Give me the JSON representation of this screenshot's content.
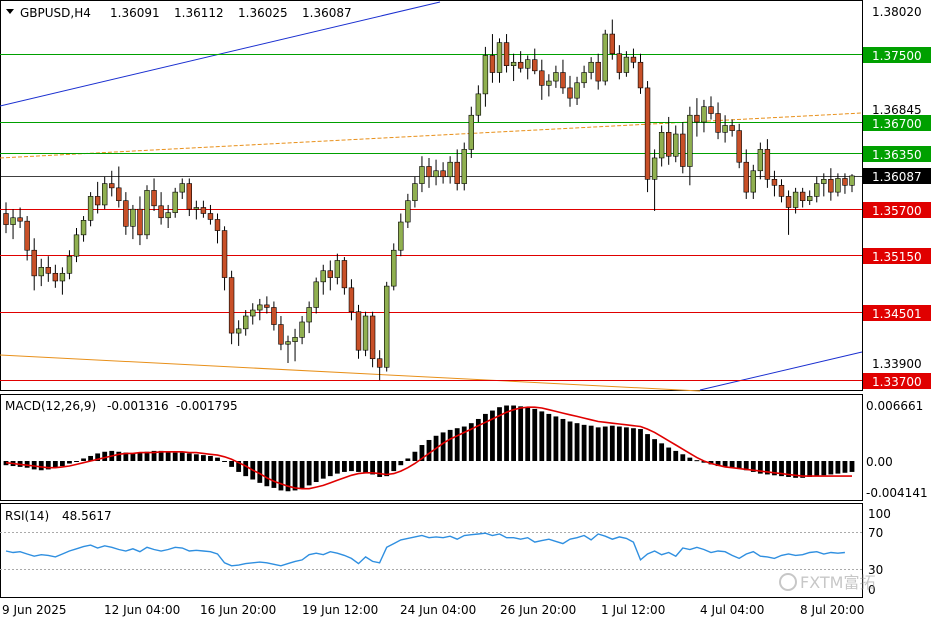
{
  "header": {
    "symbol": "GBPUSD,H4",
    "open": "1.36091",
    "high": "1.36112",
    "low": "1.36025",
    "close": "1.36087"
  },
  "macd": {
    "label": "MACD(12,26,9)",
    "main": "-0.001316",
    "signal": "-0.001795",
    "axis_ticks": [
      "0.006661",
      "0.00",
      "-0.004141"
    ]
  },
  "rsi": {
    "label": "RSI(14)",
    "value": "48.5617",
    "axis_ticks": [
      "100",
      "70",
      "30",
      "0"
    ]
  },
  "watermark": "FXTM富拓",
  "colors": {
    "bull": "#90b050",
    "bear": "#c85028",
    "support": "#e00000",
    "resistance": "#00a000",
    "trend_blue": "#1a2fd0",
    "trend_orange": "#e8901a",
    "signal": "#e00000",
    "rsi_line": "#2f8fe0"
  },
  "chart_data": [
    {
      "type": "candlestick",
      "price_range": [
        1.3333,
        1.3821
      ],
      "price_axis_ticks": [
        "1.38020",
        "1.36845",
        "1.33900"
      ],
      "current_price": "1.36087",
      "levels": {
        "resistance": [
          "1.37500",
          "1.36700",
          "1.36350"
        ],
        "support": [
          "1.35700",
          "1.35150",
          "1.34501",
          "1.33700"
        ]
      },
      "x_tick_labels": [
        "9 Jun 2025",
        "12 Jun 04:00",
        "16 Jun 20:00",
        "19 Jun 12:00",
        "24 Jun 04:00",
        "26 Jun 20:00",
        "1 Jul 12:00",
        "4 Jul 04:00",
        "8 Jul 20:00"
      ],
      "ohlc": [
        [
          1.3565,
          1.3578,
          1.3542,
          1.3552
        ],
        [
          1.3552,
          1.357,
          1.3535,
          1.356
        ],
        [
          1.356,
          1.3572,
          1.3548,
          1.3556
        ],
        [
          1.3556,
          1.3562,
          1.351,
          1.3522
        ],
        [
          1.3522,
          1.3536,
          1.3475,
          1.3492
        ],
        [
          1.3492,
          1.3512,
          1.348,
          1.3502
        ],
        [
          1.3502,
          1.3515,
          1.3485,
          1.3495
        ],
        [
          1.3495,
          1.3505,
          1.3478,
          1.3486
        ],
        [
          1.3486,
          1.3502,
          1.347,
          1.3495
        ],
        [
          1.3495,
          1.3522,
          1.3488,
          1.3515
        ],
        [
          1.3515,
          1.3548,
          1.3508,
          1.354
        ],
        [
          1.354,
          1.3562,
          1.3532,
          1.3557
        ],
        [
          1.3557,
          1.359,
          1.355,
          1.3585
        ],
        [
          1.3585,
          1.3602,
          1.3565,
          1.3575
        ],
        [
          1.3575,
          1.3608,
          1.357,
          1.36
        ],
        [
          1.36,
          1.3615,
          1.3585,
          1.3595
        ],
        [
          1.3595,
          1.362,
          1.3572,
          1.358
        ],
        [
          1.358,
          1.359,
          1.354,
          1.355
        ],
        [
          1.355,
          1.3575,
          1.3535,
          1.357
        ],
        [
          1.357,
          1.3585,
          1.3528,
          1.354
        ],
        [
          1.354,
          1.3598,
          1.3535,
          1.3592
        ],
        [
          1.3592,
          1.3606,
          1.3568,
          1.3574
        ],
        [
          1.3574,
          1.359,
          1.3552,
          1.356
        ],
        [
          1.356,
          1.3575,
          1.3548,
          1.3566
        ],
        [
          1.3566,
          1.3595,
          1.356,
          1.359
        ],
        [
          1.359,
          1.3606,
          1.3582,
          1.36
        ],
        [
          1.36,
          1.3606,
          1.3562,
          1.357
        ],
        [
          1.357,
          1.358,
          1.3558,
          1.3572
        ],
        [
          1.3572,
          1.358,
          1.356,
          1.3565
        ],
        [
          1.3565,
          1.3575,
          1.3552,
          1.3558
        ],
        [
          1.3558,
          1.3565,
          1.353,
          1.3545
        ],
        [
          1.3545,
          1.355,
          1.3475,
          1.349
        ],
        [
          1.349,
          1.3498,
          1.3412,
          1.3425
        ],
        [
          1.3425,
          1.344,
          1.341,
          1.343
        ],
        [
          1.343,
          1.3452,
          1.3422,
          1.3445
        ],
        [
          1.3445,
          1.346,
          1.3435,
          1.3452
        ],
        [
          1.3452,
          1.3465,
          1.344,
          1.3458
        ],
        [
          1.3458,
          1.3468,
          1.3448,
          1.3455
        ],
        [
          1.3455,
          1.3462,
          1.3428,
          1.3435
        ],
        [
          1.3435,
          1.3445,
          1.3405,
          1.3412
        ],
        [
          1.3412,
          1.3422,
          1.339,
          1.3415
        ],
        [
          1.3415,
          1.343,
          1.3392,
          1.342
        ],
        [
          1.342,
          1.3445,
          1.3412,
          1.3438
        ],
        [
          1.3438,
          1.3462,
          1.3425,
          1.3455
        ],
        [
          1.3455,
          1.349,
          1.3448,
          1.3485
        ],
        [
          1.3485,
          1.3505,
          1.347,
          1.3498
        ],
        [
          1.3498,
          1.351,
          1.3475,
          1.349
        ],
        [
          1.349,
          1.3518,
          1.3482,
          1.351
        ],
        [
          1.351,
          1.3514,
          1.347,
          1.3478
        ],
        [
          1.3478,
          1.3488,
          1.344,
          1.345
        ],
        [
          1.345,
          1.3458,
          1.3395,
          1.3405
        ],
        [
          1.3405,
          1.345,
          1.3398,
          1.3445
        ],
        [
          1.3445,
          1.345,
          1.3385,
          1.3395
        ],
        [
          1.3395,
          1.3405,
          1.337,
          1.3385
        ],
        [
          1.3385,
          1.3485,
          1.338,
          1.348
        ],
        [
          1.348,
          1.353,
          1.3475,
          1.3522
        ],
        [
          1.3522,
          1.3565,
          1.3515,
          1.3555
        ],
        [
          1.3555,
          1.3588,
          1.3548,
          1.358
        ],
        [
          1.358,
          1.3608,
          1.3572,
          1.36
        ],
        [
          1.36,
          1.3632,
          1.359,
          1.362
        ],
        [
          1.362,
          1.363,
          1.3595,
          1.3608
        ],
        [
          1.3608,
          1.3628,
          1.3598,
          1.3615
        ],
        [
          1.3615,
          1.3625,
          1.36,
          1.3608
        ],
        [
          1.3608,
          1.3632,
          1.36,
          1.3625
        ],
        [
          1.3625,
          1.364,
          1.3592,
          1.36
        ],
        [
          1.36,
          1.3648,
          1.3592,
          1.364
        ],
        [
          1.364,
          1.369,
          1.363,
          1.368
        ],
        [
          1.368,
          1.3715,
          1.3672,
          1.3705
        ],
        [
          1.3705,
          1.376,
          1.369,
          1.375
        ],
        [
          1.375,
          1.3775,
          1.3718,
          1.373
        ],
        [
          1.373,
          1.377,
          1.3718,
          1.3765
        ],
        [
          1.3765,
          1.3775,
          1.373,
          1.3738
        ],
        [
          1.3738,
          1.3752,
          1.372,
          1.3742
        ],
        [
          1.3742,
          1.3755,
          1.373,
          1.3735
        ],
        [
          1.3735,
          1.375,
          1.3722,
          1.3745
        ],
        [
          1.3745,
          1.3758,
          1.3728,
          1.3732
        ],
        [
          1.3732,
          1.3745,
          1.3698,
          1.3715
        ],
        [
          1.3715,
          1.3728,
          1.3702,
          1.372
        ],
        [
          1.372,
          1.3738,
          1.3712,
          1.373
        ],
        [
          1.373,
          1.3745,
          1.3705,
          1.3712
        ],
        [
          1.3712,
          1.3726,
          1.369,
          1.37
        ],
        [
          1.37,
          1.3725,
          1.3692,
          1.3718
        ],
        [
          1.3718,
          1.3738,
          1.3712,
          1.373
        ],
        [
          1.373,
          1.3748,
          1.3722,
          1.3742
        ],
        [
          1.3742,
          1.3752,
          1.371,
          1.372
        ],
        [
          1.372,
          1.378,
          1.3715,
          1.3775
        ],
        [
          1.3775,
          1.3792,
          1.3745,
          1.3752
        ],
        [
          1.3752,
          1.3762,
          1.3722,
          1.373
        ],
        [
          1.373,
          1.3755,
          1.3725,
          1.3748
        ],
        [
          1.3748,
          1.3758,
          1.3735,
          1.3742
        ],
        [
          1.3742,
          1.3752,
          1.3705,
          1.3712
        ],
        [
          1.3712,
          1.372,
          1.359,
          1.3605
        ],
        [
          1.3605,
          1.364,
          1.3568,
          1.363
        ],
        [
          1.363,
          1.3668,
          1.362,
          1.366
        ],
        [
          1.366,
          1.3678,
          1.3622,
          1.3632
        ],
        [
          1.3632,
          1.3668,
          1.3625,
          1.3658
        ],
        [
          1.3658,
          1.3672,
          1.3612,
          1.362
        ],
        [
          1.362,
          1.369,
          1.3598,
          1.368
        ],
        [
          1.368,
          1.37,
          1.3655,
          1.3672
        ],
        [
          1.3672,
          1.3698,
          1.366,
          1.369
        ],
        [
          1.369,
          1.3702,
          1.3675,
          1.3682
        ],
        [
          1.3682,
          1.3695,
          1.3652,
          1.366
        ],
        [
          1.366,
          1.368,
          1.3648,
          1.3668
        ],
        [
          1.3668,
          1.3675,
          1.3655,
          1.3662
        ],
        [
          1.3662,
          1.367,
          1.3618,
          1.3625
        ],
        [
          1.3625,
          1.364,
          1.3582,
          1.359
        ],
        [
          1.359,
          1.3622,
          1.3582,
          1.3615
        ],
        [
          1.3615,
          1.3648,
          1.3605,
          1.364
        ],
        [
          1.364,
          1.3652,
          1.3595,
          1.3605
        ],
        [
          1.3605,
          1.3615,
          1.3585,
          1.3598
        ],
        [
          1.3598,
          1.3605,
          1.3578,
          1.3585
        ],
        [
          1.3585,
          1.3592,
          1.354,
          1.3572
        ],
        [
          1.3572,
          1.3595,
          1.3565,
          1.359
        ],
        [
          1.359,
          1.3595,
          1.3572,
          1.358
        ],
        [
          1.358,
          1.3592,
          1.3575,
          1.3585
        ],
        [
          1.3585,
          1.3608,
          1.3578,
          1.36
        ],
        [
          1.36,
          1.3612,
          1.3585,
          1.3605
        ],
        [
          1.3605,
          1.3618,
          1.358,
          1.359
        ],
        [
          1.359,
          1.3612,
          1.3585,
          1.3606
        ],
        [
          1.3606,
          1.3612,
          1.3588,
          1.3598
        ],
        [
          1.3598,
          1.3611,
          1.359,
          1.3609
        ]
      ]
    },
    {
      "type": "bar",
      "name": "MACD(12,26,9)",
      "range": [
        -0.0043,
        0.0068
      ],
      "zero_line": true,
      "values": [
        -0.0005,
        -0.0006,
        -0.0007,
        -0.0008,
        -0.001,
        -0.0011,
        -0.001,
        -0.0008,
        -0.0006,
        -0.0003,
        0.0,
        0.0003,
        0.0006,
        0.0009,
        0.0011,
        0.0012,
        0.0011,
        0.001,
        0.0009,
        0.001,
        0.0011,
        0.0012,
        0.0012,
        0.0011,
        0.001,
        0.001,
        0.0009,
        0.0008,
        0.0007,
        0.0006,
        0.0004,
        0.0,
        -0.0007,
        -0.0013,
        -0.0018,
        -0.0022,
        -0.0026,
        -0.003,
        -0.0032,
        -0.0035,
        -0.0036,
        -0.0035,
        -0.0033,
        -0.0029,
        -0.0025,
        -0.0021,
        -0.0018,
        -0.0015,
        -0.0013,
        -0.0012,
        -0.0013,
        -0.0014,
        -0.0016,
        -0.0019,
        -0.0018,
        -0.0012,
        -0.0005,
        0.0003,
        0.0011,
        0.0019,
        0.0025,
        0.003,
        0.0034,
        0.0037,
        0.0039,
        0.0041,
        0.0045,
        0.005,
        0.0056,
        0.006,
        0.0064,
        0.0066,
        0.0066,
        0.0065,
        0.0064,
        0.0062,
        0.0059,
        0.0056,
        0.0053,
        0.005,
        0.0047,
        0.0045,
        0.0043,
        0.0042,
        0.004,
        0.0041,
        0.0042,
        0.0041,
        0.004,
        0.0039,
        0.0038,
        0.0032,
        0.0026,
        0.0021,
        0.0016,
        0.0012,
        0.0008,
        0.0004,
        0.0001,
        -0.0002,
        -0.0004,
        -0.0006,
        -0.0007,
        -0.0008,
        -0.0009,
        -0.0011,
        -0.0013,
        -0.0015,
        -0.0016,
        -0.0017,
        -0.0018,
        -0.0019,
        -0.002,
        -0.002,
        -0.0019,
        -0.0018,
        -0.0017,
        -0.0016,
        -0.0015,
        -0.0014,
        -0.0013
      ],
      "signal": [
        -0.0002,
        -0.0003,
        -0.0004,
        -0.0005,
        -0.0006,
        -0.0007,
        -0.0008,
        -0.0008,
        -0.0007,
        -0.0006,
        -0.0004,
        -0.0002,
        0.0,
        0.0002,
        0.0004,
        0.0006,
        0.0008,
        0.0009,
        0.0009,
        0.001,
        0.001,
        0.001,
        0.0011,
        0.0011,
        0.0011,
        0.0011,
        0.001,
        0.001,
        0.0009,
        0.0008,
        0.0007,
        0.0005,
        0.0002,
        -0.0002,
        -0.0006,
        -0.0011,
        -0.0015,
        -0.002,
        -0.0024,
        -0.0027,
        -0.003,
        -0.0032,
        -0.0033,
        -0.0033,
        -0.0031,
        -0.0029,
        -0.0026,
        -0.0023,
        -0.002,
        -0.0017,
        -0.0015,
        -0.0014,
        -0.0014,
        -0.0015,
        -0.0016,
        -0.0015,
        -0.0012,
        -0.0008,
        -0.0003,
        0.0003,
        0.0009,
        0.0015,
        0.0021,
        0.0026,
        0.003,
        0.0034,
        0.0038,
        0.0042,
        0.0046,
        0.005,
        0.0054,
        0.0058,
        0.0061,
        0.0063,
        0.0064,
        0.0064,
        0.0063,
        0.0061,
        0.0059,
        0.0057,
        0.0055,
        0.0053,
        0.0051,
        0.0049,
        0.0047,
        0.0046,
        0.0045,
        0.0044,
        0.0043,
        0.0042,
        0.0041,
        0.0038,
        0.0034,
        0.0029,
        0.0024,
        0.0019,
        0.0014,
        0.0009,
        0.0004,
        0.0,
        -0.0003,
        -0.0005,
        -0.0007,
        -0.0008,
        -0.0009,
        -0.001,
        -0.0011,
        -0.0012,
        -0.0013,
        -0.0014,
        -0.0015,
        -0.0016,
        -0.0017,
        -0.0018,
        -0.0018,
        -0.0018,
        -0.0018,
        -0.0018,
        -0.0018,
        -0.0018,
        -0.0018
      ]
    },
    {
      "type": "line",
      "name": "RSI(14)",
      "range": [
        0,
        100
      ],
      "levels": [
        70,
        30
      ],
      "values": [
        50,
        48,
        49,
        46,
        43,
        45,
        44,
        42,
        46,
        50,
        53,
        56,
        58,
        54,
        57,
        55,
        52,
        50,
        53,
        49,
        55,
        52,
        50,
        52,
        55,
        54,
        50,
        51,
        50,
        49,
        46,
        34,
        30,
        31,
        33,
        34,
        35,
        34,
        32,
        30,
        33,
        36,
        38,
        45,
        47,
        45,
        49,
        47,
        44,
        40,
        33,
        42,
        36,
        34,
        55,
        60,
        65,
        67,
        69,
        71,
        68,
        69,
        68,
        70,
        66,
        71,
        72,
        73,
        74,
        71,
        73,
        68,
        68,
        66,
        68,
        62,
        64,
        66,
        63,
        60,
        66,
        68,
        71,
        65,
        73,
        70,
        66,
        69,
        67,
        62,
        38,
        46,
        50,
        45,
        48,
        43,
        54,
        52,
        55,
        52,
        48,
        50,
        49,
        44,
        40,
        46,
        49,
        43,
        42,
        40,
        44,
        46,
        44,
        45,
        48,
        49,
        46,
        48,
        47,
        48
      ]
    }
  ]
}
